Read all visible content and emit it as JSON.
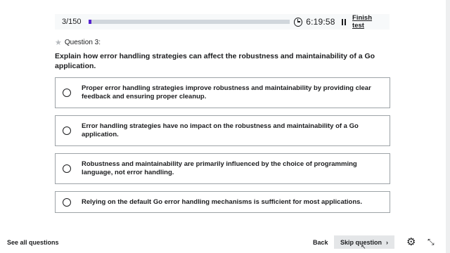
{
  "progress": {
    "text": "3/150",
    "fraction": 0.0133
  },
  "timer": "6:19:58",
  "finish_test_label": "Finish test",
  "question": {
    "label": "Question 3:",
    "text": "Explain how error handling strategies can affect the robustness and maintainability of a Go application."
  },
  "options": [
    {
      "text": "Proper error handling strategies improve robustness and maintainability by providing clear feedback and ensuring proper cleanup."
    },
    {
      "text": "Error handling strategies have no impact on the robustness and maintainability of a Go application."
    },
    {
      "text": "Robustness and maintainability are primarily influenced by the choice of programming language, not error handling."
    },
    {
      "text": "Relying on the default Go error handling mechanisms is sufficient for most applications."
    }
  ],
  "footer": {
    "see_all_label": "See all questions",
    "back_label": "Back",
    "skip_label": "Skip question"
  },
  "icons": {
    "clock": "clock-icon",
    "pause": "pause-icon",
    "star": "star-icon",
    "gear": "gear-icon",
    "collapse": "collapse-icon"
  },
  "colors": {
    "progress_fill": "#5624d0",
    "text": "#1c1d1f",
    "skip_button_bg": "#e4e6e8"
  }
}
